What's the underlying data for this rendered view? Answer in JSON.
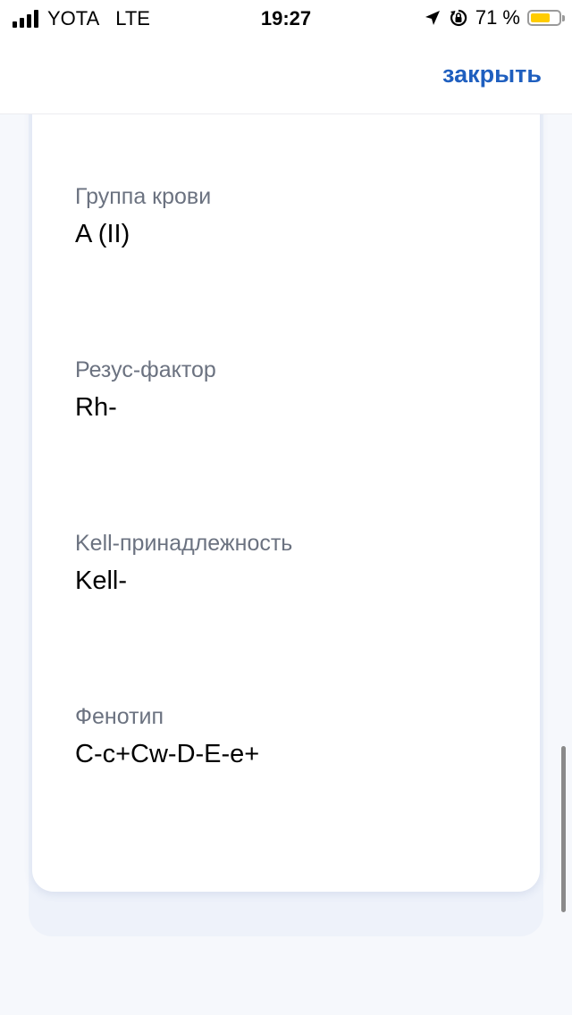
{
  "status_bar": {
    "carrier": "YOTA",
    "network": "LTE",
    "time": "19:27",
    "battery_percent": "71 %",
    "battery_level": 0.71,
    "battery_color": "#ffcc00"
  },
  "header": {
    "close_label": "закрыть",
    "accent_color": "#1f5fbf"
  },
  "fields": [
    {
      "label": "Группа крови",
      "value": "A (II)"
    },
    {
      "label": "Резус-фактор",
      "value": "Rh-"
    },
    {
      "label": "Kell-принадлежность",
      "value": "Kell-"
    },
    {
      "label": "Фенотип",
      "value": "C-c+Cw-D-E-e+"
    }
  ]
}
